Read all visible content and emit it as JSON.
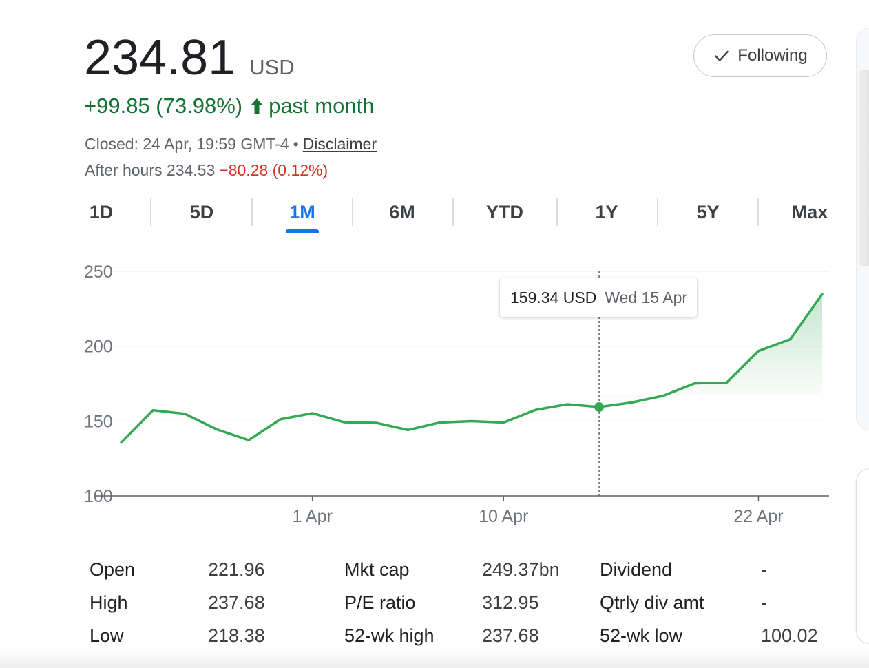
{
  "quote": {
    "price": "234.81",
    "currency": "USD",
    "change": "+99.85 (73.98%)",
    "change_period": "past month",
    "closed_text": "Closed: 24 Apr, 19:59 GMT-4",
    "separator": "•",
    "disclaimer": "Disclaimer",
    "after_hours_label": "After hours 234.53",
    "after_hours_change": "−80.28 (0.12%)",
    "colors": {
      "positive": "#137333",
      "negative": "#d93025",
      "accent": "#1a73e8",
      "line": "#34a853"
    }
  },
  "follow_button": {
    "label": "Following",
    "icon": "checkmark-icon"
  },
  "tabs": [
    {
      "label": "1D",
      "active": false
    },
    {
      "label": "5D",
      "active": false
    },
    {
      "label": "1M",
      "active": true
    },
    {
      "label": "6M",
      "active": false
    },
    {
      "label": "YTD",
      "active": false
    },
    {
      "label": "1Y",
      "active": false
    },
    {
      "label": "5Y",
      "active": false
    },
    {
      "label": "Max",
      "active": false
    }
  ],
  "chart_data": {
    "type": "area",
    "ylim": [
      100,
      250
    ],
    "y_ticks": [
      "100",
      "150",
      "200",
      "250"
    ],
    "x_ticks": [
      {
        "label": "1 Apr",
        "index": 6
      },
      {
        "label": "10 Apr",
        "index": 12
      },
      {
        "label": "22 Apr",
        "index": 20
      }
    ],
    "grid": true,
    "series": [
      {
        "values": [
          135.6,
          157.2,
          154.8,
          144.4,
          137.2,
          151.2,
          155.2,
          149.2,
          148.8,
          144.0,
          149.0,
          149.9,
          149.0,
          157.4,
          161.2,
          159.34,
          162.3,
          166.8,
          175.2,
          175.6,
          196.8,
          204.6,
          234.81
        ]
      }
    ],
    "highlight": {
      "index": 15,
      "price": "159.34 USD",
      "date": "Wed 15 Apr"
    }
  },
  "stats": {
    "col1": [
      {
        "label": "Open",
        "value": "221.96"
      },
      {
        "label": "High",
        "value": "237.68"
      },
      {
        "label": "Low",
        "value": "218.38"
      }
    ],
    "col2": [
      {
        "label": "Mkt cap",
        "value": "249.37bn"
      },
      {
        "label": "P/E ratio",
        "value": "312.95"
      },
      {
        "label": "52-wk high",
        "value": "237.68"
      }
    ],
    "col3": [
      {
        "label": "Dividend",
        "value": "-"
      },
      {
        "label": "Qtrly div amt",
        "value": "-"
      },
      {
        "label": "52-wk low",
        "value": "100.02"
      }
    ]
  }
}
